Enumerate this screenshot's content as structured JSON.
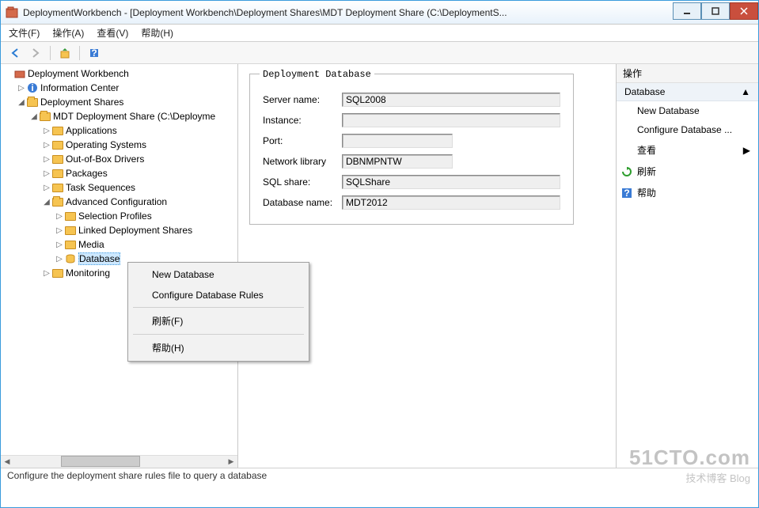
{
  "window": {
    "title": "DeploymentWorkbench - [Deployment Workbench\\Deployment Shares\\MDT Deployment Share (C:\\DeploymentS..."
  },
  "menubar": {
    "file": "文件(F)",
    "action": "操作(A)",
    "view": "查看(V)",
    "help": "帮助(H)"
  },
  "tree": {
    "root": "Deployment Workbench",
    "info": "Information Center",
    "shares": "Deployment Shares",
    "mdt": "MDT Deployment Share (C:\\Deployme",
    "apps": "Applications",
    "os": "Operating Systems",
    "drivers": "Out-of-Box Drivers",
    "packages": "Packages",
    "tasks": "Task Sequences",
    "advcfg": "Advanced Configuration",
    "profiles": "Selection Profiles",
    "linked": "Linked Deployment Shares",
    "media": "Media",
    "database": "Database",
    "monitoring": "Monitoring"
  },
  "details": {
    "legend": "Deployment Database",
    "server_lbl": "Server name:",
    "server": "SQL2008",
    "instance_lbl": "Instance:",
    "instance": "",
    "port_lbl": "Port:",
    "port": "",
    "netlib_lbl": "Network library",
    "netlib": "DBNMPNTW",
    "share_lbl": "SQL share:",
    "share": "SQLShare",
    "dbname_lbl": "Database name:",
    "dbname": "MDT2012"
  },
  "context": {
    "new": "New Database",
    "rules": "Configure Database Rules",
    "refresh": "刷新(F)",
    "help": "帮助(H)"
  },
  "actions": {
    "header": "操作",
    "group": "Database",
    "new": "New Database",
    "configure": "Configure Database ...",
    "view": "查看",
    "refresh": "刷新",
    "help": "帮助"
  },
  "status": "Configure the deployment share rules file to query a database",
  "watermark": {
    "big": "51CTO.com",
    "small": "技术博客  Blog"
  }
}
